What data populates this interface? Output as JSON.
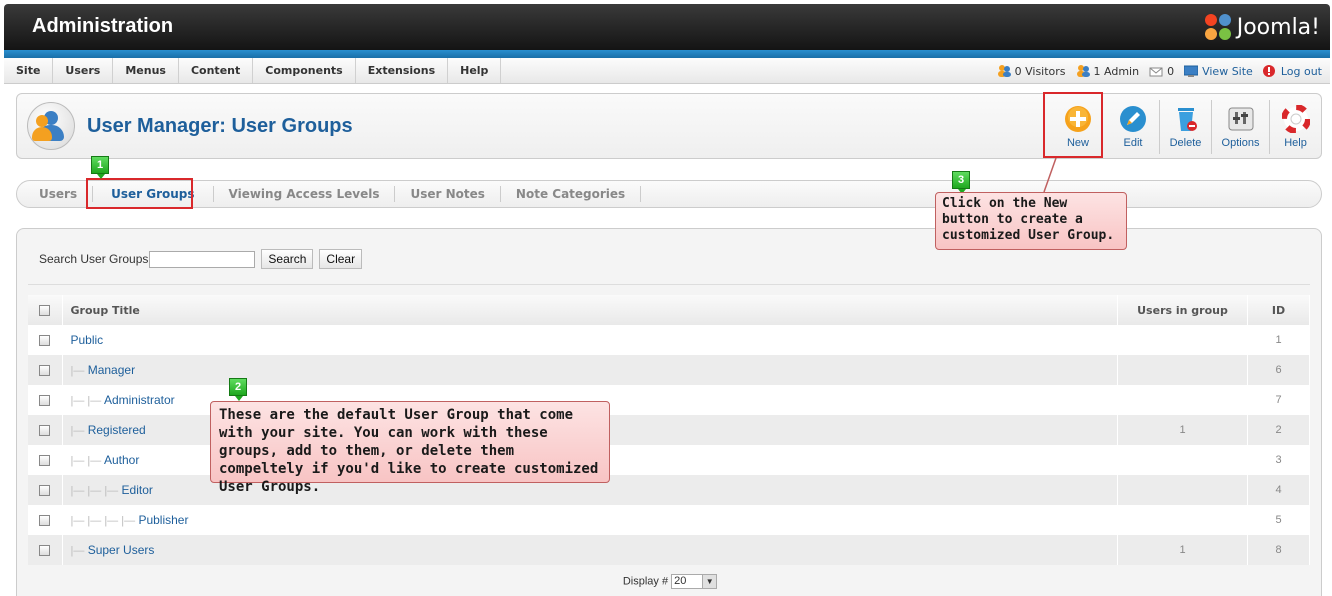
{
  "header": {
    "title": "Administration",
    "logo_text": "Joomla!"
  },
  "menu": {
    "items": [
      "Site",
      "Users",
      "Menus",
      "Content",
      "Components",
      "Extensions",
      "Help"
    ]
  },
  "status": {
    "visitors": "0 Visitors",
    "admins": "1 Admin",
    "messages": "0",
    "view_site": "View Site",
    "logout": "Log out"
  },
  "page": {
    "title": "User Manager: User Groups"
  },
  "toolbar": {
    "new": "New",
    "edit": "Edit",
    "delete": "Delete",
    "options": "Options",
    "help": "Help"
  },
  "tabs": [
    "Users",
    "User Groups",
    "Viewing Access Levels",
    "User Notes",
    "Note Categories"
  ],
  "search": {
    "label": "Search User Groups",
    "value": "",
    "search_button": "Search",
    "clear_button": "Clear"
  },
  "table": {
    "headers": {
      "title": "Group Title",
      "users": "Users in group",
      "id": "ID"
    },
    "rows": [
      {
        "prefix": "",
        "title": "Public",
        "users": "",
        "id": "1"
      },
      {
        "prefix": "|—",
        "title": "Manager",
        "users": "",
        "id": "6"
      },
      {
        "prefix": "|— |—",
        "title": "Administrator",
        "users": "",
        "id": "7"
      },
      {
        "prefix": "|—",
        "title": "Registered",
        "users": "1",
        "id": "2"
      },
      {
        "prefix": "|— |—",
        "title": "Author",
        "users": "",
        "id": "3"
      },
      {
        "prefix": "|— |— |—",
        "title": "Editor",
        "users": "",
        "id": "4"
      },
      {
        "prefix": "|— |— |— |—",
        "title": "Publisher",
        "users": "",
        "id": "5"
      },
      {
        "prefix": "|—",
        "title": "Super Users",
        "users": "1",
        "id": "8"
      }
    ]
  },
  "pagination": {
    "label": "Display #",
    "value": "20"
  },
  "annotations": {
    "badge1": "1",
    "badge2": "2",
    "badge3": "3",
    "callout2": "These are the default User Group that come with your site. You can work with these groups, add to them, or delete them compeltely if you'd like to create customized User Groups.",
    "callout3": "Click on the New button to create a customized User Group."
  },
  "colors": {
    "link": "#1e5f9b",
    "highlight": "#d9282b",
    "badge": "#1fa81f",
    "callout_bg": "#f8c4c4"
  }
}
